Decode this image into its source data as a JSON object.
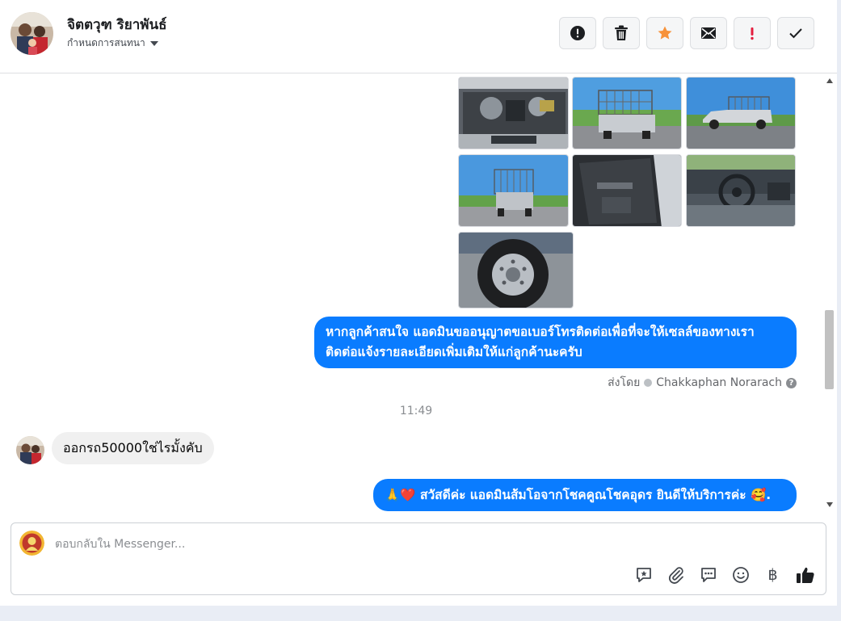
{
  "header": {
    "contact_name": "จิตตวุฑ ริยาพันธ์",
    "conversation_settings": "กำหนดการสนทนา",
    "actions": [
      {
        "name": "report-spam-button",
        "icon": "alert-circle-icon"
      },
      {
        "name": "delete-button",
        "icon": "trash-icon"
      },
      {
        "name": "star-button",
        "icon": "star-icon"
      },
      {
        "name": "mark-unread-button",
        "icon": "envelope-icon"
      },
      {
        "name": "follow-up-button",
        "icon": "exclamation-icon"
      },
      {
        "name": "mark-done-button",
        "icon": "checkmark-icon"
      }
    ]
  },
  "messages": {
    "outgoing_1_line1": "หากลูกค้าสนใจ แอดมินขออนุญาตขอเบอร์โทรติดต่อเพื่อที่จะให้เซลล์ของทางเรา",
    "outgoing_1_line2": "ติดต่อแจ้งรายละเอียดเพิ่มเติมให้แก่ลูกค้านะครับ",
    "sent_by_label": "ส่งโดย",
    "sent_by_name": "Chakkaphan Norarach",
    "help_glyph": "?",
    "timestamp": "11:49",
    "incoming_1": "ออกรถ50000ใช่ไรมั้งคับ",
    "outgoing_2": "สวัสดีค่ะ แอดมินส้มโอจากโชคคูณโชคอุดร ยินดีให้บริการค่ะ",
    "outgoing_2_prefix_emoji": "🙏❤️",
    "outgoing_2_suffix_emoji": "🥰."
  },
  "composer": {
    "placeholder": "ตอบกลับใน Messenger...",
    "currency_glyph": "฿",
    "tools": [
      "saved-reply-icon",
      "attachment-icon",
      "chat-bubbles-icon",
      "emoji-icon",
      "payment-icon",
      "thumbs-up-icon"
    ]
  },
  "colors": {
    "outgoing_bubble": "#0a7cff",
    "incoming_bubble": "#f0f0f0",
    "star": "#f7923a",
    "follow_up": "#e41e3f"
  }
}
